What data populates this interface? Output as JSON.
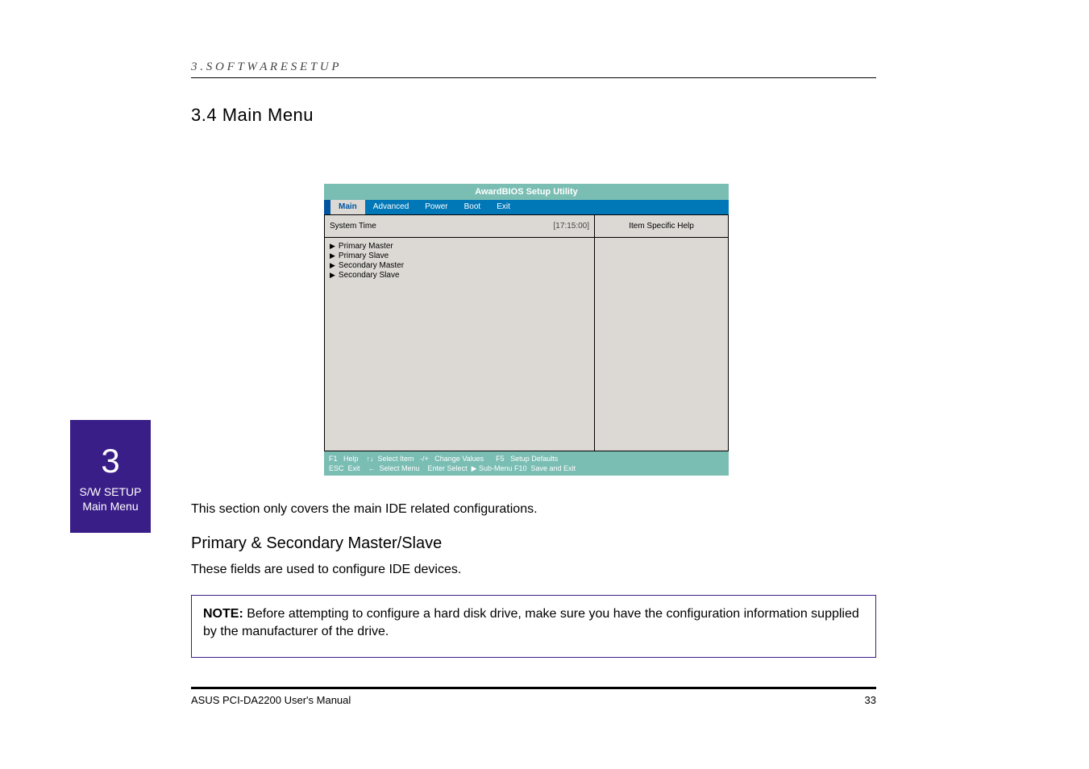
{
  "header": "3 . S O F T W A R E   S E T U P",
  "section_title": "3.4 Main Menu",
  "bios": {
    "title": "AwardBIOS Setup Utility",
    "tabs": [
      "Main",
      "Advanced",
      "Power",
      "Boot",
      "Exit"
    ],
    "main_row": {
      "label": "System Time",
      "value": "[17:15:00]"
    },
    "submenu": [
      "Primary Master",
      "Primary Slave",
      "Secondary Master",
      "Secondary Slave"
    ],
    "help_header": "Item Specific Help",
    "footer": {
      "row1": "F1   Help    ↑↓  Select Item   -/+   Change Values      F5   Setup Defaults",
      "row2": "ESC  Exit    ←  Select Menu    Enter Select  ▶ Sub-Menu F10  Save and Exit"
    }
  },
  "sidetab": {
    "big": "3",
    "line1": "S/W SETUP",
    "line2": "Main Menu"
  },
  "para1": "This section only covers the main IDE related configurations.",
  "subheading": "Primary & Secondary Master/Slave",
  "para2": "These fields are used to configure IDE devices.",
  "note": {
    "bold": "NOTE:",
    "text": " Before attempting to configure a hard disk drive, make sure you have the configuration information supplied by the manufacturer of the drive."
  },
  "footer_left": "ASUS PCI-DA2200 User's Manual",
  "footer_right": "33"
}
